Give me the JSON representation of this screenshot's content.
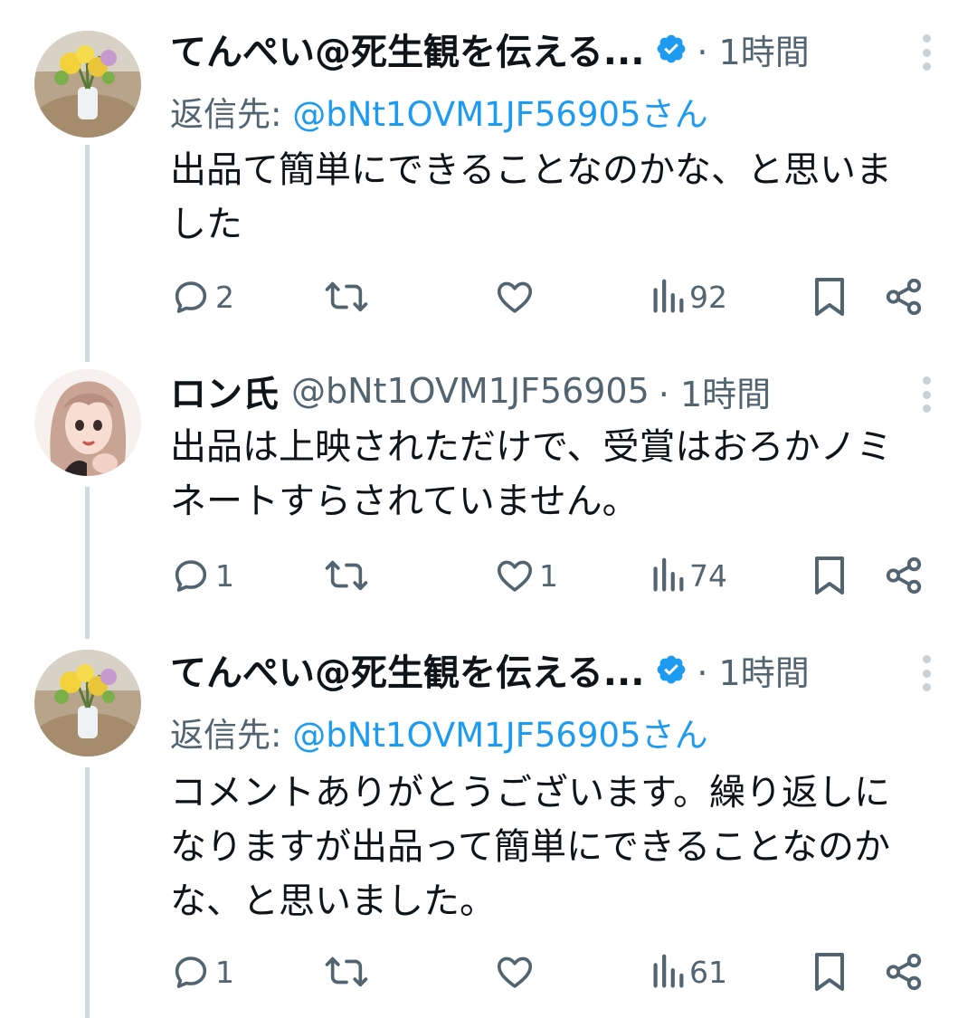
{
  "tweets": [
    {
      "display_name": "てんぺい@死生観を伝える...",
      "verified": true,
      "handle": "",
      "time": "· 1時間",
      "reply_prefix": "返信先: ",
      "reply_mention": "@bNt1OVM1JF56905さん",
      "text": "出品て簡単にできることなのかな、と思いました",
      "counts": {
        "reply": "2",
        "retweet": "",
        "like": "",
        "views": "92"
      }
    },
    {
      "display_name": "ロン氏",
      "verified": false,
      "handle": "@bNt1OVM1JF56905",
      "time": "· 1時間",
      "reply_prefix": "",
      "reply_mention": "",
      "text": "出品は上映されただけで、受賞はおろかノミネートすらされていません。",
      "counts": {
        "reply": "1",
        "retweet": "",
        "like": "1",
        "views": "74"
      }
    },
    {
      "display_name": "てんぺい@死生観を伝える...",
      "verified": true,
      "handle": "",
      "time": "· 1時間",
      "reply_prefix": "返信先: ",
      "reply_mention": "@bNt1OVM1JF56905さん",
      "text": "コメントありがとうございます。繰り返しになりますが出品って簡単にできることなのかな、と思いました。",
      "counts": {
        "reply": "1",
        "retweet": "",
        "like": "",
        "views": "61"
      }
    }
  ],
  "icons": {
    "reply": "speech-bubble-icon",
    "retweet": "retweet-arrows-icon",
    "like": "heart-icon",
    "views": "bar-chart-icon",
    "bookmark": "bookmark-icon",
    "share": "share-icon",
    "more": "vertical-dots-icon",
    "verified": "verified-badge-icon"
  },
  "colors": {
    "link": "#1d9bf0",
    "secondary_text": "#536471",
    "thread_line": "#cfd9de",
    "verified_badge": "#1d9bf0"
  }
}
